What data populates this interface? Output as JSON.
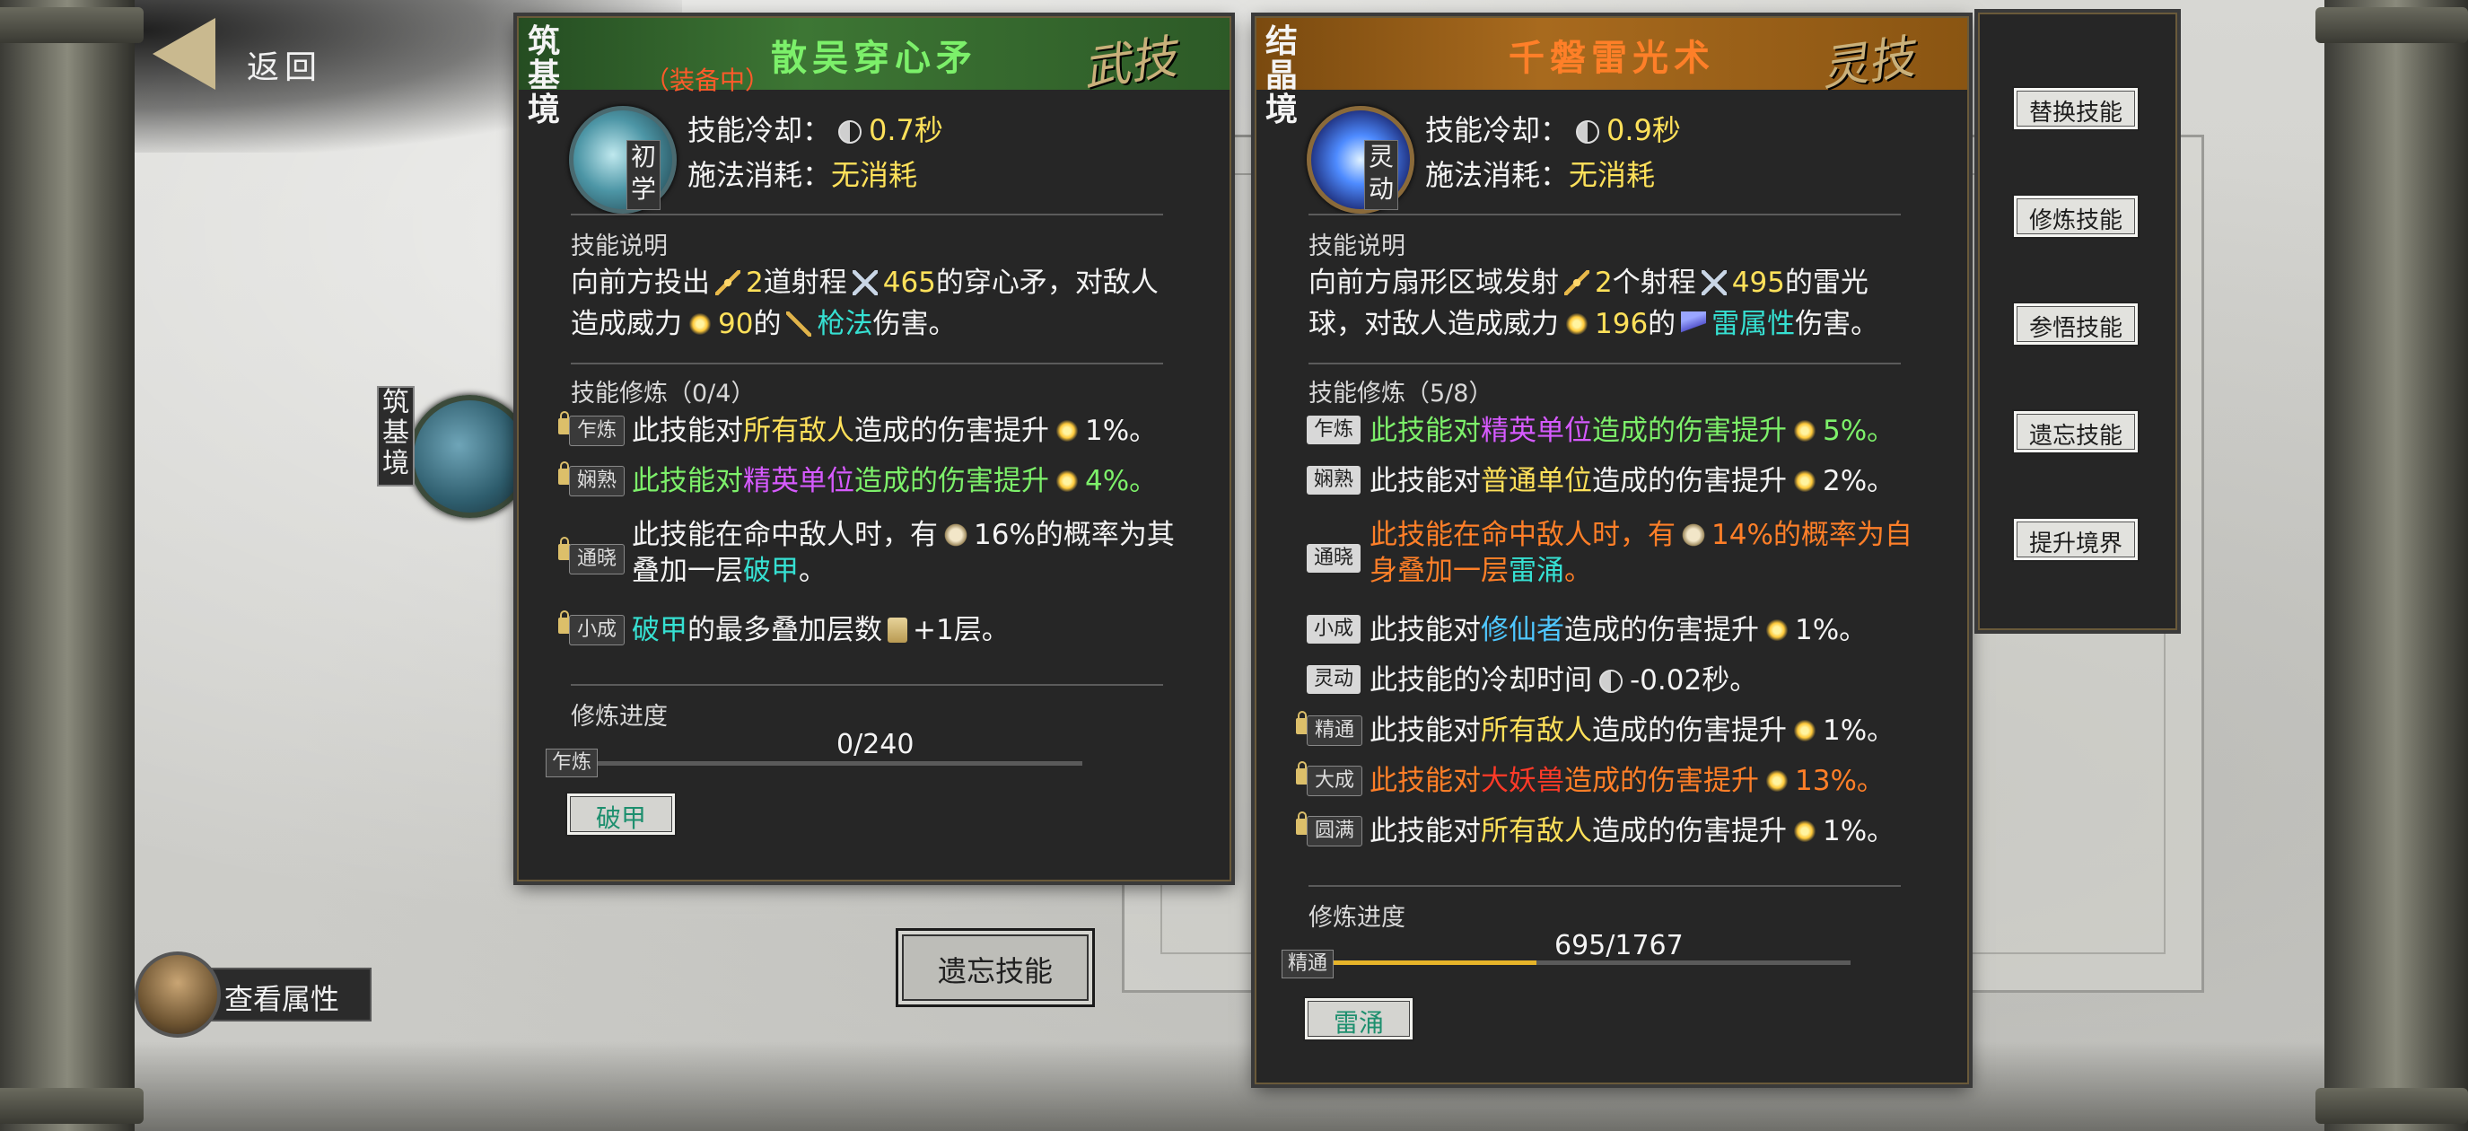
{
  "nav": {
    "back_label": "返回"
  },
  "character": {
    "realm": "筑基境",
    "view_attributes_label": "查看属性"
  },
  "background": {
    "forget_label": "遗忘技能"
  },
  "left_skill": {
    "realm": "筑基境",
    "name": "散吴穿心矛",
    "type_tag": "武技",
    "equipped": "（装备中）",
    "level": "初学",
    "cooldown_label": "技能冷却：",
    "cooldown_value": "0.7秒",
    "cost_label": "施法消耗：",
    "cost_value": "无消耗",
    "desc_title": "技能说明",
    "desc": {
      "p1": "向前方投出",
      "count": "2",
      "p2": "道射程",
      "range": "465",
      "p3": "的穿心矛，对敌人",
      "p4": "造成威力",
      "power": "90",
      "p5": "的",
      "dmg_type": "枪法",
      "p6": "伤害。"
    },
    "mod_title": "技能修炼（0/4）",
    "mods": [
      {
        "level": "乍炼",
        "t1": "此技能对",
        "h1": "所有敌人",
        "t2": "造成的伤害提升",
        "v": "1%。"
      },
      {
        "level": "娴熟",
        "t1": "此技能对",
        "h1": "精英单位",
        "t2": "造成的伤害提升",
        "v": "4%。"
      },
      {
        "level": "通晓",
        "t1": "此技能在命中敌人时，有",
        "v": "16%的概率为其",
        "t2": "叠加一层",
        "h1": "破甲",
        "t3": "。"
      },
      {
        "level": "小成",
        "h1": "破甲",
        "t1": "的最多叠加层数",
        "v": "+1层。"
      }
    ],
    "progress_title": "修炼进度",
    "progress_level": "乍炼",
    "progress_text": "0/240",
    "progress_fraction": 0.0,
    "effect_button": "破甲"
  },
  "right_skill": {
    "realm": "结晶境",
    "name": "千磐雷光术",
    "type_tag": "灵技",
    "level": "灵动",
    "cooldown_label": "技能冷却：",
    "cooldown_value": "0.9秒",
    "cost_label": "施法消耗：",
    "cost_value": "无消耗",
    "desc_title": "技能说明",
    "desc": {
      "p1": "向前方扇形区域发射",
      "count": "2",
      "p2": "个射程",
      "range": "495",
      "p3": "的雷光",
      "p4": "球，对敌人造成威力",
      "power": "196",
      "p5": "的",
      "dmg_type": "雷属性",
      "p6": "伤害。"
    },
    "mod_title": "技能修炼（5/8）",
    "mods": [
      {
        "level": "乍炼",
        "t1": "此技能对",
        "h1": "精英单位",
        "t2": "造成的伤害提升",
        "v": "5%。"
      },
      {
        "level": "娴熟",
        "t1": "此技能对",
        "h1": "普通单位",
        "t2": "造成的伤害提升",
        "v": "2%。"
      },
      {
        "level": "通晓",
        "t1": "此技能在命中敌人时，有",
        "v": "14%的概率为自",
        "t2": "身叠加一层",
        "h1": "雷涌",
        "t3": "。"
      },
      {
        "level": "小成",
        "t1": "此技能对",
        "h1": "修仙者",
        "t2": "造成的伤害提升",
        "v": "1%。"
      },
      {
        "level": "灵动",
        "t1": "此技能的冷却时间",
        "v": "-0.02秒。"
      },
      {
        "level": "精通",
        "t1": "此技能对",
        "h1": "所有敌人",
        "t2": "造成的伤害提升",
        "v": "1%。"
      },
      {
        "level": "大成",
        "t1": "此技能对",
        "h1": "大妖兽",
        "t2": "造成的伤害提升",
        "v": "13%。"
      },
      {
        "level": "圆满",
        "t1": "此技能对",
        "h1": "所有敌人",
        "t2": "造成的伤害提升",
        "v": "1%。"
      }
    ],
    "progress_title": "修炼进度",
    "progress_level": "精通",
    "progress_text": "695/1767",
    "progress_fraction": 0.393,
    "effect_button": "雷涌"
  },
  "side_actions": [
    "替换技能",
    "修炼技能",
    "参悟技能",
    "遗忘技能",
    "提升境界"
  ]
}
